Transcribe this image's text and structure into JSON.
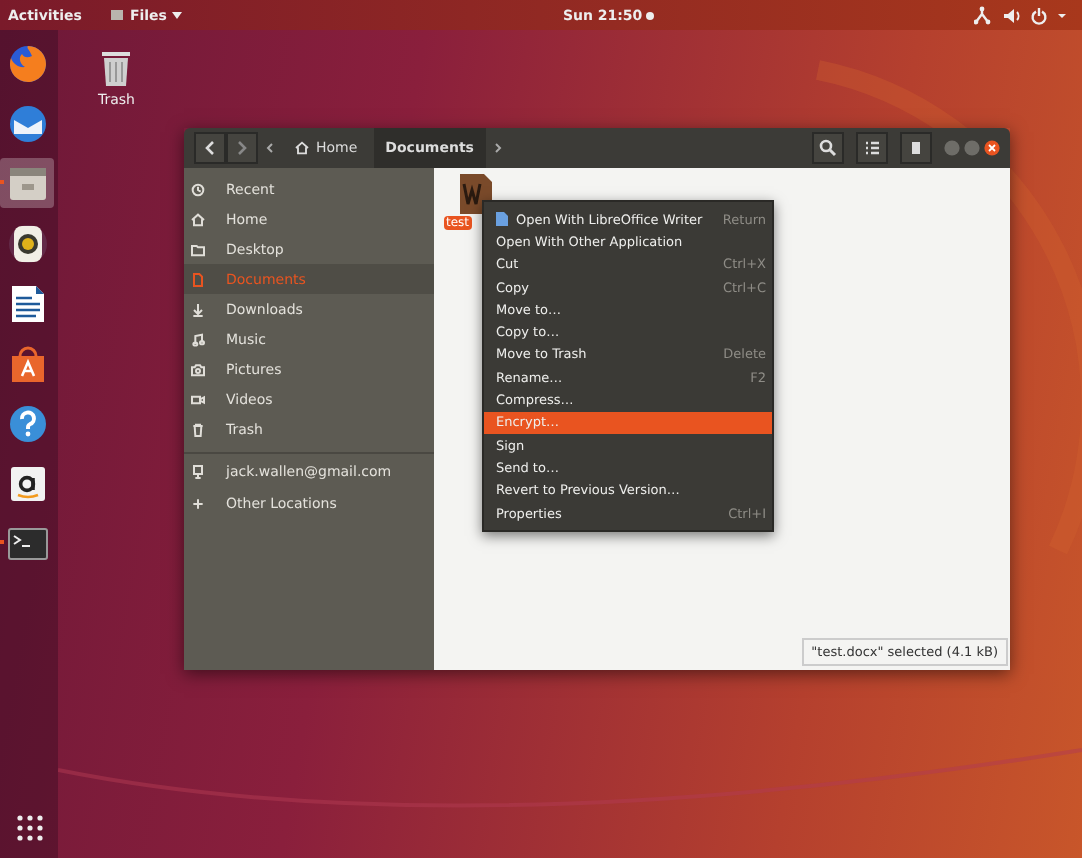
{
  "top_bar": {
    "activities": "Activities",
    "app_menu": "Files",
    "clock": "Sun 21:50"
  },
  "dock": [
    {
      "kind": "browser",
      "selected": false,
      "running": false
    },
    {
      "kind": "mail",
      "selected": false,
      "running": false
    },
    {
      "kind": "files",
      "selected": true,
      "running": true
    },
    {
      "kind": "music",
      "selected": false,
      "running": false
    },
    {
      "kind": "writer",
      "selected": false,
      "running": false
    },
    {
      "kind": "software",
      "selected": false,
      "running": false
    },
    {
      "kind": "help",
      "selected": false,
      "running": false
    },
    {
      "kind": "amazon",
      "selected": false,
      "running": false
    },
    {
      "kind": "terminal",
      "selected": false,
      "running": true
    }
  ],
  "desktop_icons": [
    {
      "label": "Trash"
    }
  ],
  "window": {
    "path": [
      {
        "label": "Home",
        "selected": false
      },
      {
        "label": "Documents",
        "selected": true
      }
    ],
    "sidebar": [
      {
        "kind": "recent",
        "label": "Recent",
        "selected": false
      },
      {
        "kind": "home",
        "label": "Home",
        "selected": false
      },
      {
        "kind": "folder",
        "label": "Desktop",
        "selected": false
      },
      {
        "kind": "document",
        "label": "Documents",
        "selected": true
      },
      {
        "kind": "download",
        "label": "Downloads",
        "selected": false
      },
      {
        "kind": "music",
        "label": "Music",
        "selected": false
      },
      {
        "kind": "camera",
        "label": "Pictures",
        "selected": false
      },
      {
        "kind": "video",
        "label": "Videos",
        "selected": false
      },
      {
        "kind": "trash",
        "label": "Trash",
        "selected": false
      },
      {
        "kind": "account",
        "label": "jack.wallen@gmail.com",
        "selected": false
      },
      {
        "kind": "add",
        "label": "Other Locations",
        "selected": false
      }
    ],
    "files": [
      {
        "label": "test",
        "selected": true
      }
    ],
    "context_menu": [
      {
        "kind": "app",
        "label": "Open With LibreOffice Writer",
        "shortcut": "Return",
        "selected": false
      },
      {
        "kind": "plain",
        "label": "Open With Other Application",
        "selected": false
      },
      {
        "kind": "plain",
        "label": "Cut",
        "shortcut": "Ctrl+X",
        "selected": false
      },
      {
        "kind": "plain",
        "label": "Copy",
        "shortcut": "Ctrl+C",
        "selected": false
      },
      {
        "kind": "plain",
        "label": "Move to…",
        "selected": false
      },
      {
        "kind": "plain",
        "label": "Copy to…",
        "selected": false
      },
      {
        "kind": "plain",
        "label": "Move to Trash",
        "shortcut": "Delete",
        "selected": false
      },
      {
        "kind": "plain",
        "label": "Rename…",
        "shortcut": "F2",
        "selected": false
      },
      {
        "kind": "plain",
        "label": "Compress…",
        "selected": false
      },
      {
        "kind": "plain",
        "label": "Encrypt…",
        "selected": true
      },
      {
        "kind": "plain",
        "label": "Sign",
        "selected": false
      },
      {
        "kind": "plain",
        "label": "Send to…",
        "selected": false
      },
      {
        "kind": "plain",
        "label": "Revert to Previous Version…",
        "selected": false
      },
      {
        "kind": "plain",
        "label": "Properties",
        "shortcut": "Ctrl+I",
        "selected": false
      }
    ],
    "status": "\"test.docx\" selected (4.1 kB)"
  }
}
